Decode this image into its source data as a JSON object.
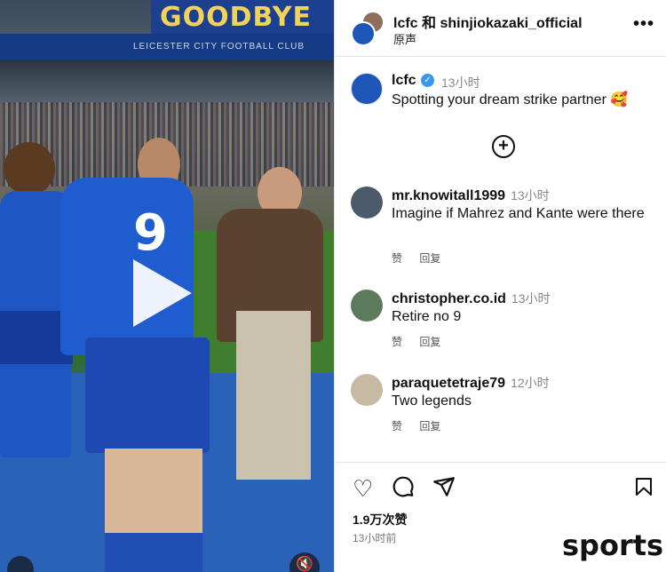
{
  "header": {
    "title": "lcfc 和 shinjiokazaki_official",
    "subtitle": "原声",
    "more_icon": "more-horizontal-icon"
  },
  "media": {
    "banner_text": "GOODBYE GOAT",
    "stadium_text": "LEICESTER CITY FOOTBALL CLUB",
    "jersey_number": "9",
    "play_icon": "play-icon",
    "mute_icon": "mute-icon"
  },
  "caption": {
    "username": "lcfc",
    "time": "13小时",
    "text": "Spotting your dream strike partner 🥰"
  },
  "load_more_icon": "plus-circle-icon",
  "comments": [
    {
      "username": "mr.knowitall1999",
      "time": "13小时",
      "text": "Imagine if Mahrez and Kante were there",
      "like": "赞",
      "reply": "回复",
      "avatar_color": "#4a5a6a"
    },
    {
      "username": "christopher.co.id",
      "time": "13小时",
      "text": "Retire no 9",
      "like": "赞",
      "reply": "回复",
      "avatar_color": "#5c7a5c"
    },
    {
      "username": "paraquetetraje79",
      "time": "12小时",
      "text": "Two legends",
      "like": "赞",
      "reply": "回复",
      "avatar_color": "#c8b9a2"
    }
  ],
  "actions": {
    "like_icon": "heart-icon",
    "comment_icon": "comment-icon",
    "share_icon": "share-icon",
    "save_icon": "bookmark-icon",
    "likes": "1.9万次赞",
    "time": "13小时前"
  },
  "watermark": "sports",
  "colors": {
    "verified": "#3897f0",
    "lcfc_blue": "#1d56b8"
  }
}
